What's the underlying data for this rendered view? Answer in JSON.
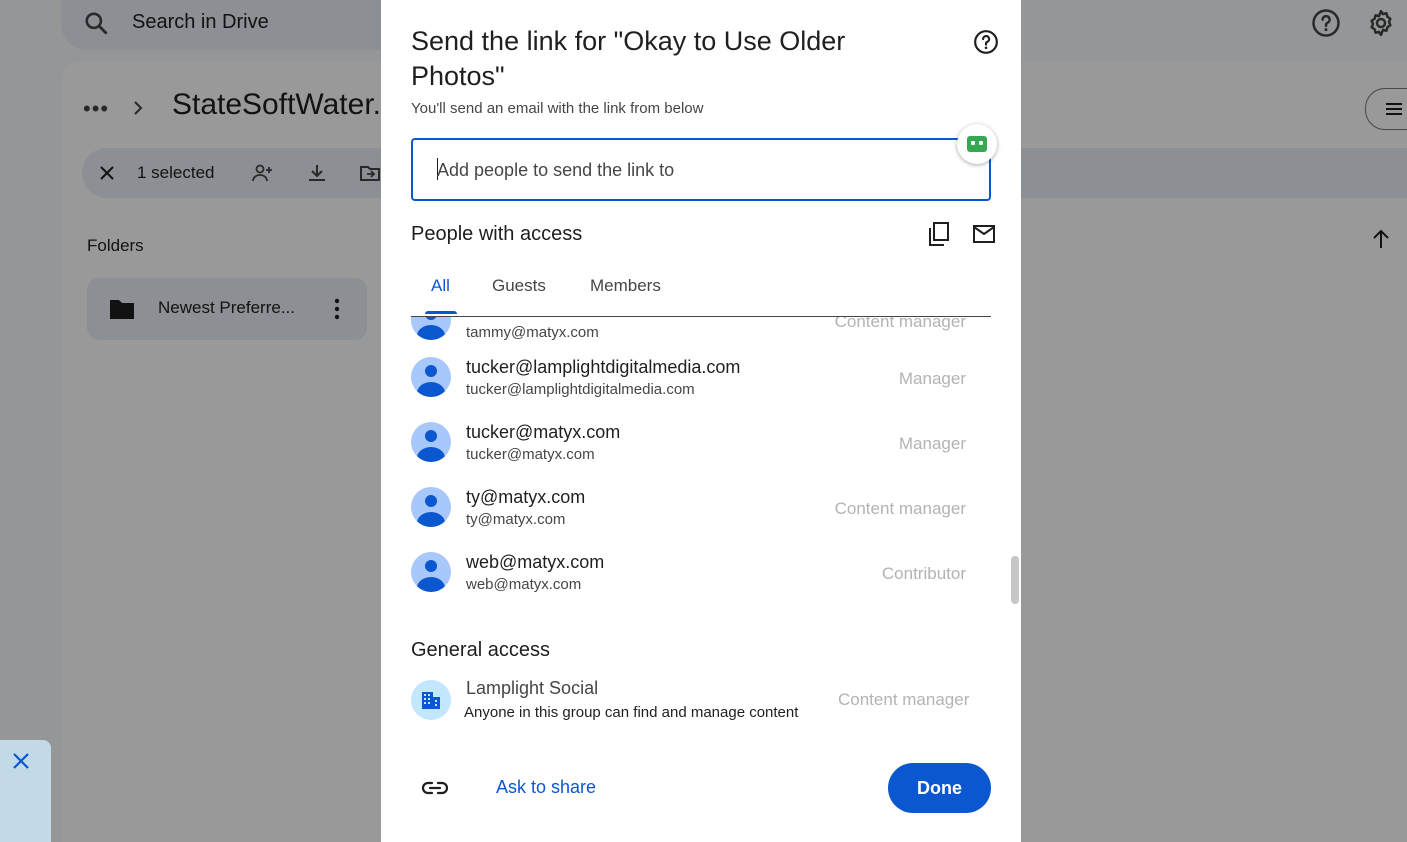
{
  "app": {
    "search": {
      "placeholder": "Search in Drive"
    },
    "breadcrumb": {
      "ellipsis": "•••",
      "title": "StateSoftWater."
    },
    "selection": {
      "count_label": "1 selected"
    },
    "folders": {
      "label": "Folders",
      "items": [
        {
          "name": "Newest Preferre..."
        }
      ]
    },
    "icons": [
      "search-icon",
      "help-icon",
      "settings-icon",
      "close-icon",
      "add-person-icon",
      "download-icon",
      "move-to-folder-icon",
      "folder-icon",
      "more-vert-icon",
      "arrow-up-icon",
      "list-view-icon"
    ]
  },
  "dialog": {
    "title": "Send the link for \"Okay to Use Older Photos\"",
    "subtitle": "You'll send an email with the link from below",
    "input_placeholder": "Add people to send the link to",
    "people_section_title": "People with access",
    "tabs": [
      {
        "label": "All",
        "active": true
      },
      {
        "label": "Guests",
        "active": false
      },
      {
        "label": "Members",
        "active": false
      }
    ],
    "people": [
      {
        "name": "",
        "email": "tammy@matyx.com",
        "role": "Content manager",
        "partially_visible": true
      },
      {
        "name": "tucker@lamplightdigitalmedia.com",
        "email": "tucker@lamplightdigitalmedia.com",
        "role": "Manager"
      },
      {
        "name": "tucker@matyx.com",
        "email": "tucker@matyx.com",
        "role": "Manager"
      },
      {
        "name": "ty@matyx.com",
        "email": "ty@matyx.com",
        "role": "Content manager"
      },
      {
        "name": "web@matyx.com",
        "email": "web@matyx.com",
        "role": "Contributor"
      }
    ],
    "general_access": {
      "title": "General access",
      "name": "Lamplight Social",
      "description": "Anyone in this group can find and manage content",
      "role": "Content manager"
    },
    "footer": {
      "ask_to_share": "Ask to share",
      "done": "Done"
    },
    "colors": {
      "accent": "#0b57d0",
      "role_text": "#b3b3b3",
      "avatar_bg": "#a8c7fa"
    },
    "icons": [
      "help-icon",
      "copy-link-icon",
      "email-icon",
      "link-icon",
      "domain-icon",
      "extension-icon"
    ]
  }
}
